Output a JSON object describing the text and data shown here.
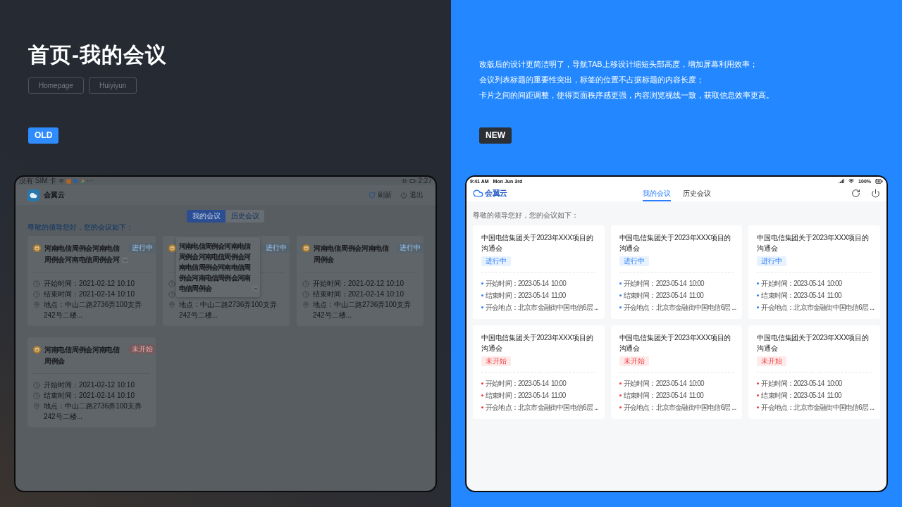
{
  "slide": {
    "title": "首页-我的会议",
    "tags": [
      "Homepage",
      "Huiyiyun"
    ]
  },
  "old_design": {
    "badge": "OLD",
    "device": {
      "status_bar": {
        "carrier": "没有 SIM 卡",
        "more": "···",
        "time": "2:27"
      },
      "app_name": "会翼云",
      "actions": [
        {
          "kind": "refresh",
          "label": "刷新"
        },
        {
          "kind": "power",
          "label": "退出"
        }
      ],
      "tabs": [
        {
          "label": "我的会议",
          "selected": true
        },
        {
          "label": "历史会议",
          "selected": false
        }
      ],
      "greeting": "尊敬的领导您好，您的会议如下：",
      "cards": [
        {
          "title": "河南电信周例会河南电信周例会河南电信周例会河",
          "expanded": false,
          "status": {
            "label": "进行中",
            "kind": "ongoing"
          },
          "rows": [
            {
              "kind": "time",
              "text": "开始时间：2021-02-12 10:10"
            },
            {
              "kind": "time",
              "text": "结束时间：2021-02-14 10:10"
            },
            {
              "kind": "place",
              "text": "地点：中山二路2736弄100支弄242号二楼..."
            }
          ]
        },
        {
          "title": "河南电信周例会河南电信周例会河南电信周例会河南电信周例会河南电信周例会河南电信周例会河南电信周例会",
          "expanded": true,
          "status": {
            "label": "进行中",
            "kind": "ongoing"
          },
          "rows": [
            {
              "kind": "time"
            },
            {
              "kind": "time"
            },
            {
              "kind": "place",
              "text": "地点：中山二路2736弄100支弄242号二楼..."
            }
          ]
        },
        {
          "title": "河南电信周例会河南电信周例会",
          "status": {
            "label": "进行中",
            "kind": "ongoing"
          },
          "rows": [
            {
              "kind": "time",
              "text": "开始时间：2021-02-12 10:10"
            },
            {
              "kind": "time",
              "text": "结束时间：2021-02-14 10:10"
            },
            {
              "kind": "place",
              "text": "地点：中山二路2736弄100支弄242号二楼..."
            }
          ]
        },
        {
          "title": "河南电信周例会河南电信周例会",
          "status": {
            "label": "未开始",
            "kind": "upcoming"
          },
          "rows": [
            {
              "kind": "time",
              "text": "开始时间：2021-02-12 10:10"
            },
            {
              "kind": "time",
              "text": "结束时间：2021-02-14 10:10"
            },
            {
              "kind": "place",
              "text": "地点：中山二路2736弄100支弄242号二楼..."
            }
          ]
        }
      ]
    }
  },
  "new_design": {
    "notes": [
      "改版后的设计更简洁明了，导航TAB上移设计缩短头部高度，增加屏幕利用效率；",
      "会议列表标题的重要性突出，标签的位置不占据标题的内容长度；",
      "卡片之间的间距调整，使得页面秩序感更强，内容浏览视线一致，获取信息效率更高。"
    ],
    "badge": "NEW",
    "device": {
      "status_bar": {
        "time": "9:41 AM",
        "date": "Mon Jun 3rd",
        "battery": "100%"
      },
      "app_name": "会翼云",
      "tabs": [
        {
          "label": "我的会议",
          "selected": true
        },
        {
          "label": "历史会议",
          "selected": false
        }
      ],
      "actions": [
        {
          "kind": "refresh"
        },
        {
          "kind": "power"
        }
      ],
      "greeting": "尊敬的领导您好，您的会议如下：",
      "cards": [
        {
          "title": "中国电信集团关于2023年XXX项目的沟通会",
          "status": {
            "label": "进行中",
            "kind": "ongoing"
          },
          "rows": [
            "开始时间：2023-05-14  10:00",
            "结束时间：2023-05-14  11:00",
            "开会地点：北京市金融街中国电信6层 ..."
          ]
        },
        {
          "title": "中国电信集团关于2023年XXX项目的沟通会",
          "status": {
            "label": "进行中",
            "kind": "ongoing"
          },
          "rows": [
            "开始时间：2023-05-14  10:00",
            "结束时间：2023-05-14  11:00",
            "开会地点：北京市金融街中国电信6层 ..."
          ]
        },
        {
          "title": "中国电信集团关于2023年XXX项目的沟通会",
          "status": {
            "label": "进行中",
            "kind": "ongoing"
          },
          "rows": [
            "开始时间：2023-05-14  10:00",
            "结束时间：2023-05-14  11:00",
            "开会地点：北京市金融街中国电信6层 ..."
          ]
        },
        {
          "title": "中国电信集团关于2023年XXX项目的沟通会",
          "status": {
            "label": "未开始",
            "kind": "upcoming"
          },
          "rows": [
            "开始时间：2023-05-14  10:00",
            "结束时间：2023-05-14  11:00",
            "开会地点：北京市金融街中国电信6层 ..."
          ]
        },
        {
          "title": "中国电信集团关于2023年XXX项目的沟通会",
          "status": {
            "label": "未开始",
            "kind": "upcoming"
          },
          "rows": [
            "开始时间：2023-05-14  10:00",
            "结束时间：2023-05-14  11:00",
            "开会地点：北京市金融街中国电信6层 ..."
          ]
        },
        {
          "title": "中国电信集团关于2023年XXX项目的沟通会",
          "status": {
            "label": "未开始",
            "kind": "upcoming"
          },
          "rows": [
            "开始时间：2023-05-14  10:00",
            "结束时间：2023-05-14  11:00",
            "开会地点：北京市金融街中国电信6层 ..."
          ]
        }
      ]
    }
  }
}
